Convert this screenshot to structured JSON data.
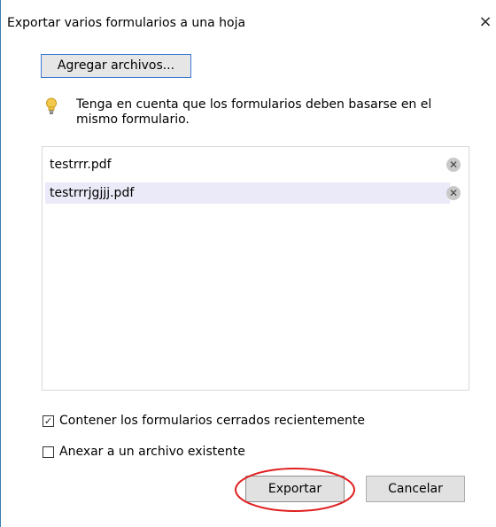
{
  "dialog": {
    "title": "Exportar varios formularios a una hoja",
    "close_glyph": "×"
  },
  "add_files_button": {
    "label": "Agregar archivos..."
  },
  "note": {
    "icon": "lightbulb-icon",
    "text": "Tenga en cuenta que los formularios deben basarse en el mismo formulario."
  },
  "files": [
    {
      "name": "testrrr.pdf",
      "selected": false
    },
    {
      "name": "testrrrjgjjj.pdf",
      "selected": true
    }
  ],
  "options": {
    "include_recent": {
      "label": "Contener los formularios cerrados recientemente",
      "checked": true
    },
    "append_existing": {
      "label": "Anexar a un archivo existente",
      "checked": false
    }
  },
  "buttons": {
    "export": "Exportar",
    "cancel": "Cancelar"
  },
  "colors": {
    "accent_border": "#3b7ad4",
    "selected_row": "#ebeaf8",
    "annotation_circle": "#e02020"
  }
}
